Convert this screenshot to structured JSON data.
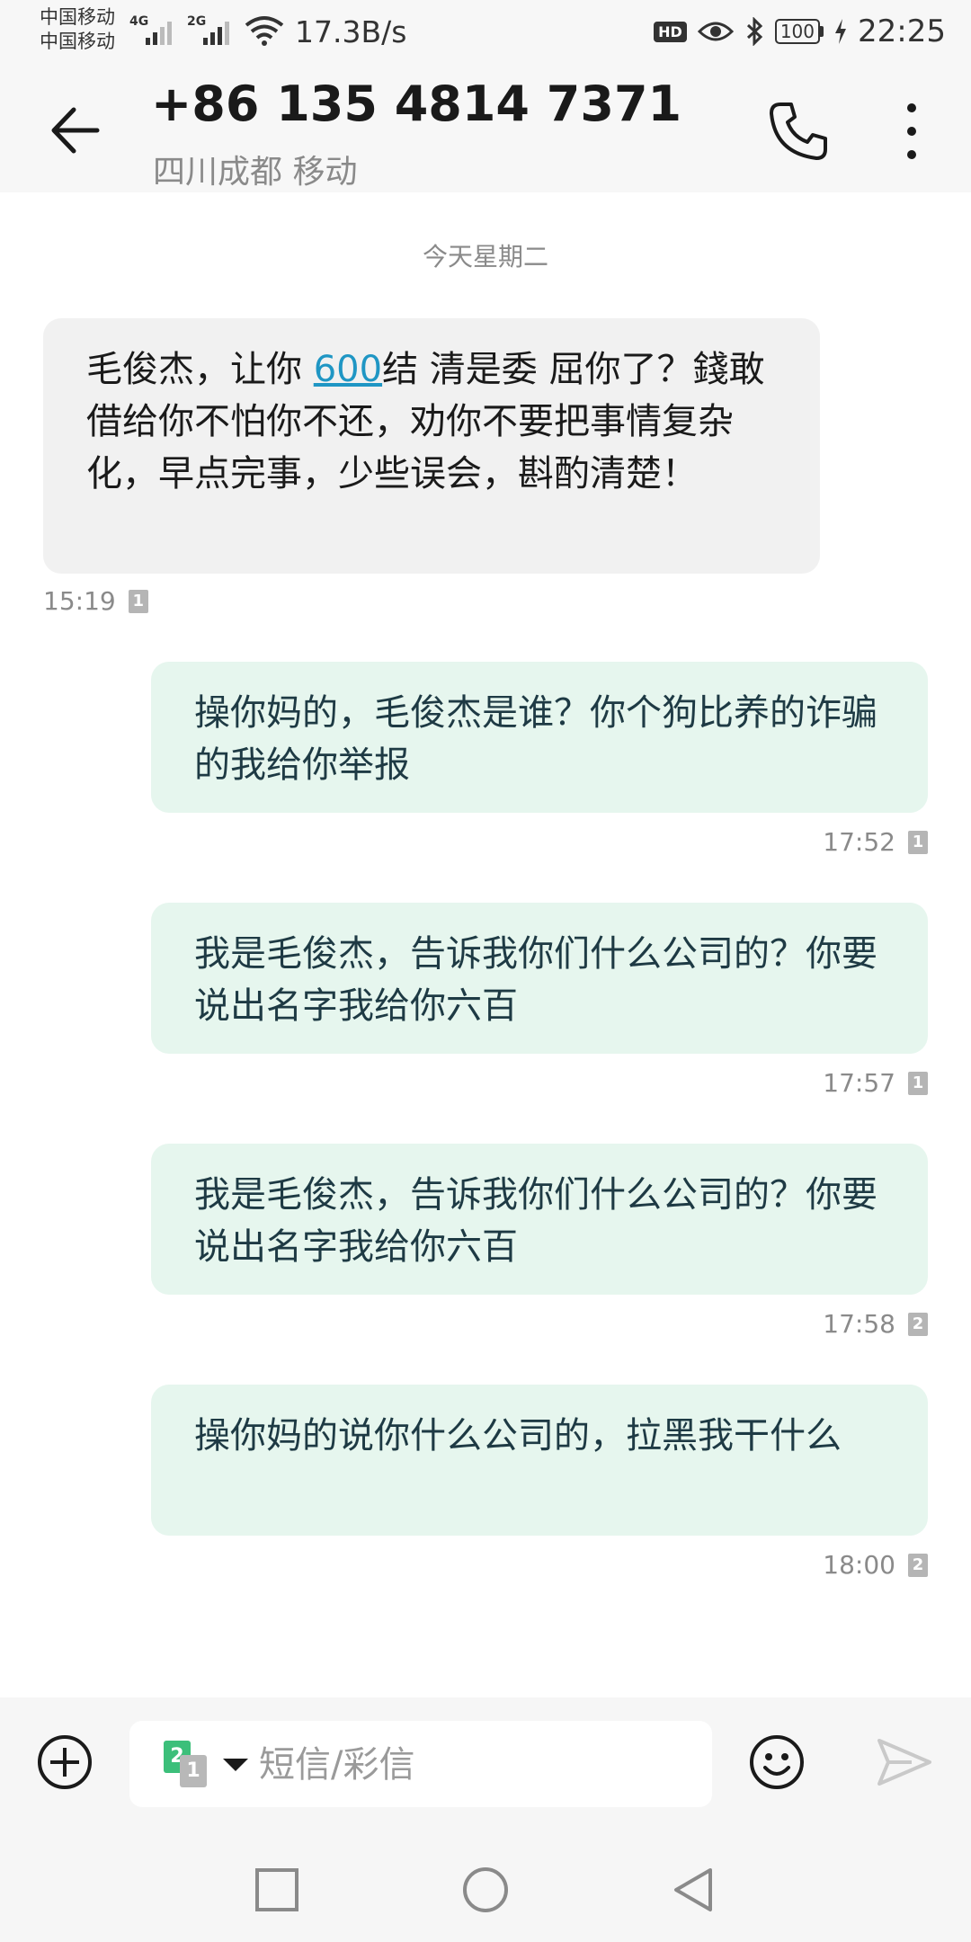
{
  "status_bar": {
    "carrier_1": "中国移动",
    "carrier_2": "中国移动",
    "network_1": "4G",
    "network_2": "2G",
    "speed": "17.3B/s",
    "hd_label": "HD",
    "battery": "100",
    "time": "22:25"
  },
  "header": {
    "contact_number": "+86 135 4814 7371",
    "contact_location": "四川成都 移动"
  },
  "conversation": {
    "day_separator": "今天星期二",
    "messages": [
      {
        "direction": "incoming",
        "text_before_link": "毛俊杰，让你 ",
        "link": "600",
        "text_after_link": "结 清是委 屈你了？錢敢借给你不怕你不还，劝你不要把事情复杂化，早点完事，少些误会，斟酌清楚！",
        "time": "15:19",
        "sim": "1"
      },
      {
        "direction": "outgoing",
        "text": "操你妈的，毛俊杰是谁？你个狗比养的诈骗的我给你举报",
        "time": "17:52",
        "sim": "1"
      },
      {
        "direction": "outgoing",
        "text": "我是毛俊杰，告诉我你们什么公司的？你要说出名字我给你六百",
        "time": "17:57",
        "sim": "1"
      },
      {
        "direction": "outgoing",
        "text": "我是毛俊杰，告诉我你们什么公司的？你要说出名字我给你六百",
        "time": "17:58",
        "sim": "2"
      },
      {
        "direction": "outgoing",
        "text": "操你妈的说你什么公司的，拉黑我干什么",
        "time": "18:00",
        "sim": "2"
      }
    ]
  },
  "composer": {
    "sim_primary": "2",
    "sim_secondary": "1",
    "placeholder": "短信/彩信"
  },
  "colors": {
    "incoming_bubble": "#f1f1f1",
    "outgoing_bubble": "#e6f6ee",
    "link": "#1f96c4",
    "sim2_green": "#3cbf7a"
  },
  "icons": {
    "back": "arrow-left-icon",
    "call": "phone-icon",
    "more": "more-vertical-icon",
    "add": "add-circle-icon",
    "emoji": "emoji-icon",
    "send": "send-icon",
    "nav_recent": "square-icon",
    "nav_home": "circle-icon",
    "nav_back": "triangle-back-icon"
  }
}
